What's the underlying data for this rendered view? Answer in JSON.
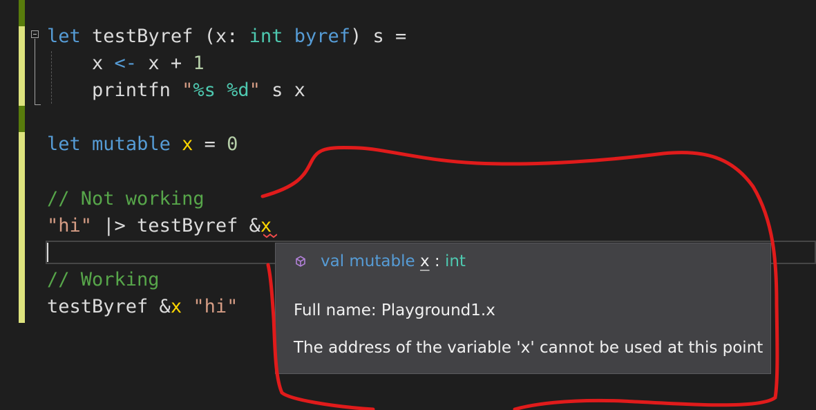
{
  "code": {
    "line1": {
      "kw_let": "let",
      "name": "testByref",
      "open": " (",
      "param": "x",
      "colon": ": ",
      "type": "int",
      "sp": " ",
      "byref": "byref",
      "rest": ") s ="
    },
    "line2": {
      "indent": "    ",
      "lhs": "x ",
      "op": "<-",
      "rhs": " x + ",
      "num": "1"
    },
    "line3": {
      "indent": "    ",
      "fn": "printfn ",
      "q1": "\"",
      "fmt1": "%s",
      "sp": " ",
      "fmt2": "%d",
      "q2": "\"",
      "args": " s x"
    },
    "line4": {
      "kw_let": "let",
      "sp": " ",
      "kw_mutable": "mutable",
      "var": "x",
      "eq": " = ",
      "num": "0"
    },
    "line5": {
      "comment": "// Not working"
    },
    "line6": {
      "str": "\"hi\"",
      "pipe": " |> testByref &",
      "var": "x"
    },
    "line7": {
      "comment": "// Working"
    },
    "line8": {
      "call": "testByref &",
      "var": "x",
      "sp": " ",
      "str": "\"hi\""
    }
  },
  "tooltip": {
    "icon": "field-cube-icon",
    "sig_keyword": "val mutable",
    "sig_name": "x",
    "sig_colon": " : ",
    "sig_type": "int",
    "full_name": "Full name: Playground1.x",
    "error": "The address of the variable 'x' cannot be used at this point"
  },
  "colors": {
    "background": "#1e1e1e",
    "keyword": "#569cd6",
    "type": "#4ec9b0",
    "string": "#d69d85",
    "comment": "#57a64a",
    "mutable": "#ffd700",
    "annotation": "#e01b1b"
  }
}
